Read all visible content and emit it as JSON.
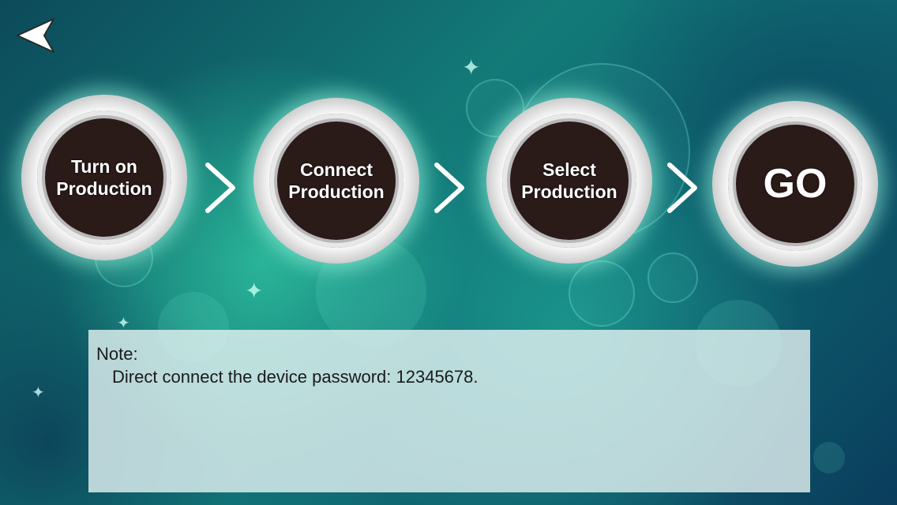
{
  "nav": {
    "back_icon": "back-arrow-icon"
  },
  "steps": [
    {
      "label": "Turn on\nProduction"
    },
    {
      "label": "Connect\nProduction"
    },
    {
      "label": "Select\nProduction"
    },
    {
      "label": "GO"
    }
  ],
  "arrows": {
    "icon": "chevron-right-icon"
  },
  "note": {
    "title": "Note:",
    "text": "Direct connect the device password: 12345678."
  },
  "colors": {
    "background": "#137a78",
    "glow": "#a0ffe6",
    "circle_fill": "#2a1a18",
    "note_bg": "#e1f0f0"
  }
}
